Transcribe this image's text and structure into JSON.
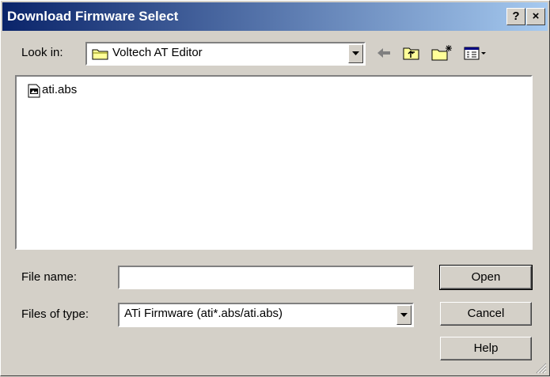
{
  "window": {
    "title": "Download Firmware Select",
    "help_btn": "?",
    "close_btn": "×"
  },
  "look_in": {
    "label": "Look in:",
    "value": "Voltech AT Editor"
  },
  "files": [
    {
      "name": "ati.abs"
    }
  ],
  "file_name": {
    "label": "File name:",
    "value": ""
  },
  "files_of_type": {
    "label": "Files of type:",
    "value": "ATi Firmware (ati*.abs/ati.abs)"
  },
  "buttons": {
    "open": "Open",
    "cancel": "Cancel",
    "help": "Help"
  },
  "colors": {
    "title_start": "#0a246a",
    "title_end": "#a6caf0",
    "face": "#d4d0c8"
  }
}
